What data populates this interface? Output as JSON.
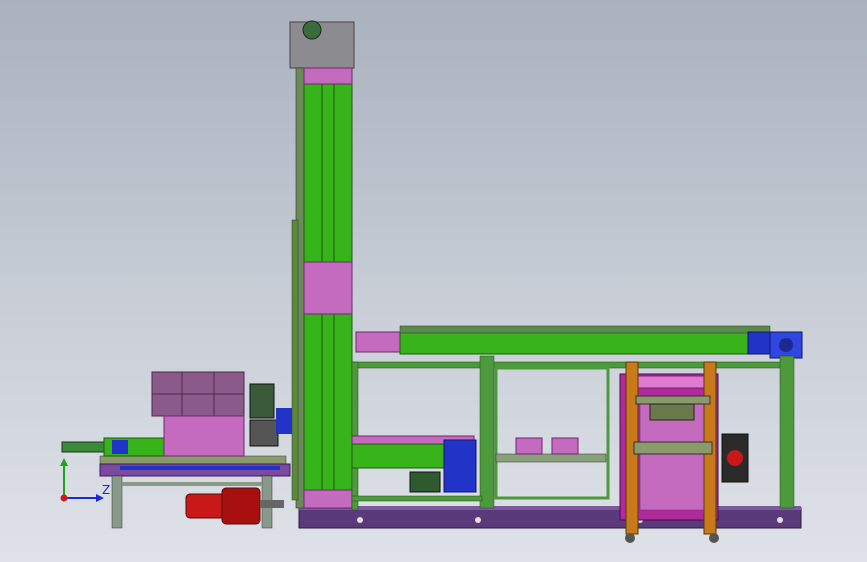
{
  "viewport": {
    "background_top": "#a9b1bd",
    "background_bottom": "#dfe2e8"
  },
  "colors": {
    "green": "#36b41a",
    "magenta": "#c56bbf",
    "purple": "#5a3a7a",
    "blue": "#2233c8",
    "red": "#c81818",
    "orange": "#c87a1a",
    "gray": "#7f7f85",
    "frame_green": "#4c9a3c",
    "axis_y": "#1aa51a",
    "axis_z": "#1b2bd6",
    "axis_origin": "#d01818"
  },
  "triad": {
    "z_label": "Z"
  }
}
